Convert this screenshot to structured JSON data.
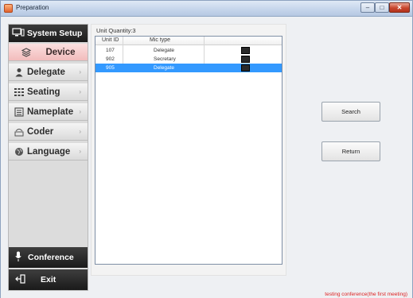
{
  "window": {
    "title": "Preparation"
  },
  "sidebar": {
    "header": "System Setup",
    "items": [
      {
        "label": "Device",
        "icon": "layers-icon",
        "active": true
      },
      {
        "label": "Delegate",
        "icon": "person-icon"
      },
      {
        "label": "Seating",
        "icon": "seating-grid-icon"
      },
      {
        "label": "Nameplate",
        "icon": "nameplate-icon"
      },
      {
        "label": "Coder",
        "icon": "coder-icon"
      },
      {
        "label": "Language",
        "icon": "globe-icon"
      }
    ],
    "conference": "Conference",
    "exit": "Exit"
  },
  "main": {
    "quantity_label": "Unit Quantity:3",
    "columns": [
      "Unit ID",
      "Mic type"
    ],
    "rows": [
      {
        "id": "107",
        "mic": "Delegate",
        "selected": false
      },
      {
        "id": "902",
        "mic": "Secretary",
        "selected": false
      },
      {
        "id": "905",
        "mic": "Delegate",
        "selected": true
      }
    ]
  },
  "buttons": {
    "search": "Search",
    "return": "Return"
  },
  "status": {
    "text": "testing conference(the first meeting)"
  },
  "colors": {
    "accent": "#3399ff",
    "status_text": "#dd2222",
    "active_item": "#f2bcbc"
  }
}
